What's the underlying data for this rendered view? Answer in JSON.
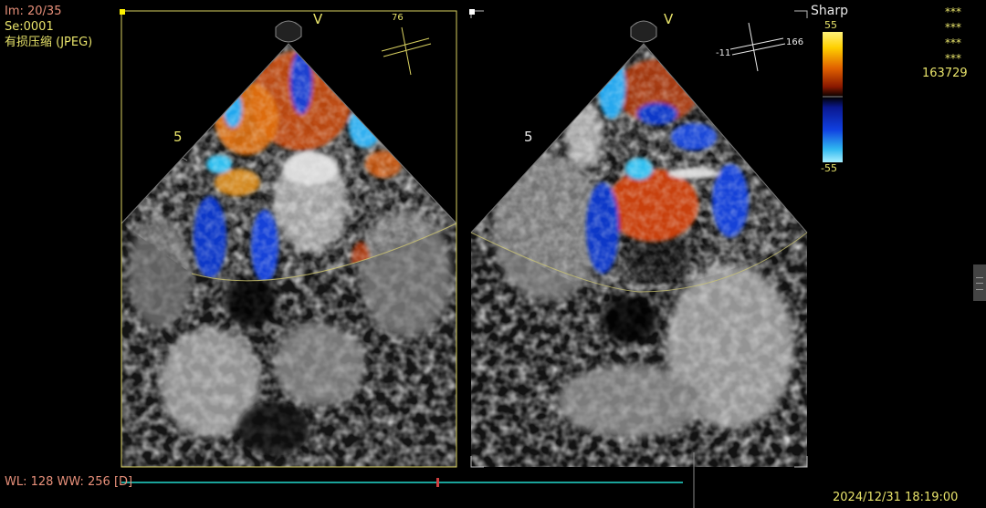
{
  "overlay": {
    "image_index": "Im: 20/35",
    "series": "Se:0001",
    "compression": "有损压缩 (JPEG)",
    "window_level": "WL: 128 WW: 256 [D]",
    "datetime": "2024/12/31 18:19:00",
    "anon": [
      "***",
      "***",
      "***",
      "***"
    ],
    "patient_id": "163729"
  },
  "left_view": {
    "apex_marker": "V",
    "depth_marker": "5",
    "angle": "76"
  },
  "right_view": {
    "apex_marker": "V",
    "depth_marker": "5",
    "angle_left": "-11",
    "angle_right": "166"
  },
  "color_scale": {
    "mode": "Sharp",
    "max": "55",
    "min": "-55"
  },
  "colors": {
    "frame": "#d8d060",
    "overlay_salmon": "#e8907a",
    "overlay_yellow": "#e8e36a",
    "timeline": "#1aa39a",
    "timeline_marker": "#d04040"
  }
}
